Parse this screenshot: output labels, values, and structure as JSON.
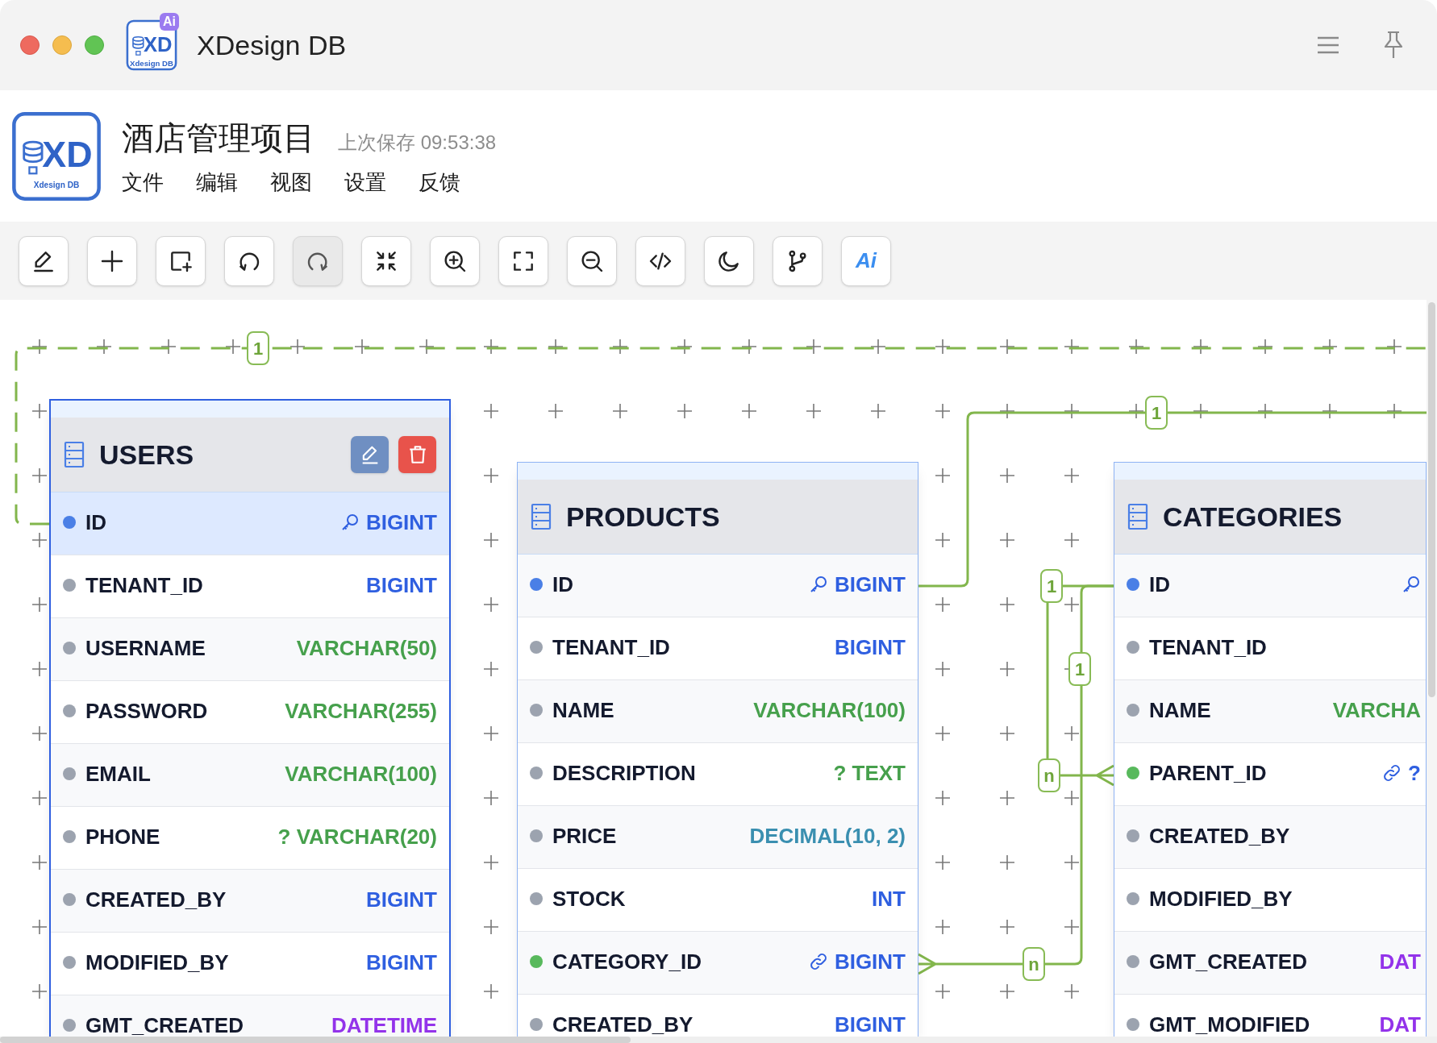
{
  "window": {
    "title": "XDesign DB",
    "app_icon": {
      "mark": "XD",
      "caption": "Xdesign DB",
      "badge": "Ai"
    }
  },
  "header": {
    "logo": {
      "mark": "XD",
      "caption": "Xdesign DB"
    },
    "project": "酒店管理项目",
    "saved": "上次保存 09:53:38",
    "menu": [
      "文件",
      "编辑",
      "视图",
      "设置",
      "反馈"
    ]
  },
  "toolbar": [
    {
      "kind": "edit",
      "pressed": false
    },
    {
      "kind": "add",
      "pressed": false
    },
    {
      "kind": "add-frame",
      "pressed": false
    },
    {
      "kind": "undo",
      "pressed": false
    },
    {
      "kind": "redo",
      "pressed": true
    },
    {
      "kind": "fit",
      "pressed": false
    },
    {
      "kind": "zoom-in",
      "pressed": false
    },
    {
      "kind": "fullscreen",
      "pressed": false
    },
    {
      "kind": "zoom-out",
      "pressed": false
    },
    {
      "kind": "code",
      "pressed": false
    },
    {
      "kind": "theme",
      "pressed": false
    },
    {
      "kind": "branch",
      "pressed": false
    },
    {
      "kind": "ai",
      "label": "Ai",
      "pressed": false
    }
  ],
  "tables": [
    {
      "name": "USERS",
      "selected": true,
      "fields": [
        {
          "name": "ID",
          "kind": "pk",
          "type": "BIGINT",
          "color": "#2f5fe0",
          "highlighted": true
        },
        {
          "name": "TENANT_ID",
          "kind": "plain",
          "type": "BIGINT",
          "color": "#2f5fe0",
          "highlighted": false
        },
        {
          "name": "USERNAME",
          "kind": "plain",
          "type": "VARCHAR(50)",
          "color": "#46a04c",
          "highlighted": false
        },
        {
          "name": "PASSWORD",
          "kind": "plain",
          "type": "VARCHAR(255)",
          "color": "#46a04c",
          "highlighted": false
        },
        {
          "name": "EMAIL",
          "kind": "plain",
          "type": "VARCHAR(100)",
          "color": "#46a04c",
          "highlighted": false
        },
        {
          "name": "PHONE",
          "kind": "plain",
          "type": "? VARCHAR(20)",
          "color": "#46a04c",
          "highlighted": false
        },
        {
          "name": "CREATED_BY",
          "kind": "plain",
          "type": "BIGINT",
          "color": "#2f5fe0",
          "highlighted": false
        },
        {
          "name": "MODIFIED_BY",
          "kind": "plain",
          "type": "BIGINT",
          "color": "#2f5fe0",
          "highlighted": false
        },
        {
          "name": "GMT_CREATED",
          "kind": "plain",
          "type": "DATETIME",
          "color": "#9333ea",
          "highlighted": false
        }
      ]
    },
    {
      "name": "PRODUCTS",
      "selected": false,
      "fields": [
        {
          "name": "ID",
          "kind": "pk",
          "type": "BIGINT",
          "color": "#2f5fe0",
          "highlighted": false
        },
        {
          "name": "TENANT_ID",
          "kind": "plain",
          "type": "BIGINT",
          "color": "#2f5fe0",
          "highlighted": false
        },
        {
          "name": "NAME",
          "kind": "plain",
          "type": "VARCHAR(100)",
          "color": "#46a04c",
          "highlighted": false
        },
        {
          "name": "DESCRIPTION",
          "kind": "plain",
          "type": "? TEXT",
          "color": "#46a04c",
          "highlighted": false
        },
        {
          "name": "PRICE",
          "kind": "plain",
          "type": "DECIMAL(10, 2)",
          "color": "#3a8fb0",
          "highlighted": false
        },
        {
          "name": "STOCK",
          "kind": "plain",
          "type": "INT",
          "color": "#2f5fe0",
          "highlighted": false
        },
        {
          "name": "CATEGORY_ID",
          "kind": "fk",
          "type": "BIGINT",
          "color": "#2f5fe0",
          "highlighted": false
        },
        {
          "name": "CREATED_BY",
          "kind": "plain",
          "type": "BIGINT",
          "color": "#2f5fe0",
          "highlighted": false
        }
      ]
    },
    {
      "name": "CATEGORIES",
      "selected": false,
      "fields": [
        {
          "name": "ID",
          "kind": "pk",
          "highlighted": false
        },
        {
          "name": "TENANT_ID",
          "kind": "plain",
          "highlighted": false
        },
        {
          "name": "NAME",
          "kind": "plain",
          "type": "VARCHA",
          "color": "#46a04c",
          "highlighted": false
        },
        {
          "name": "PARENT_ID",
          "kind": "fk",
          "type": "?",
          "color": "#2f5fe0",
          "highlighted": false
        },
        {
          "name": "CREATED_BY",
          "kind": "plain",
          "highlighted": false
        },
        {
          "name": "MODIFIED_BY",
          "kind": "plain",
          "highlighted": false
        },
        {
          "name": "GMT_CREATED",
          "kind": "plain",
          "type": "DAT",
          "color": "#9333ea",
          "highlighted": false
        },
        {
          "name": "GMT_MODIFIED",
          "kind": "plain",
          "type": "DAT",
          "color": "#9333ea",
          "highlighted": false
        }
      ]
    }
  ],
  "relations": [
    {
      "kind": "dashed",
      "labels": [
        "1"
      ]
    },
    {
      "kind": "solid",
      "labels": [
        "1"
      ]
    },
    {
      "kind": "solid",
      "labels": [
        "1",
        "n"
      ]
    },
    {
      "kind": "solid",
      "labels": [
        "1",
        "n"
      ]
    }
  ]
}
